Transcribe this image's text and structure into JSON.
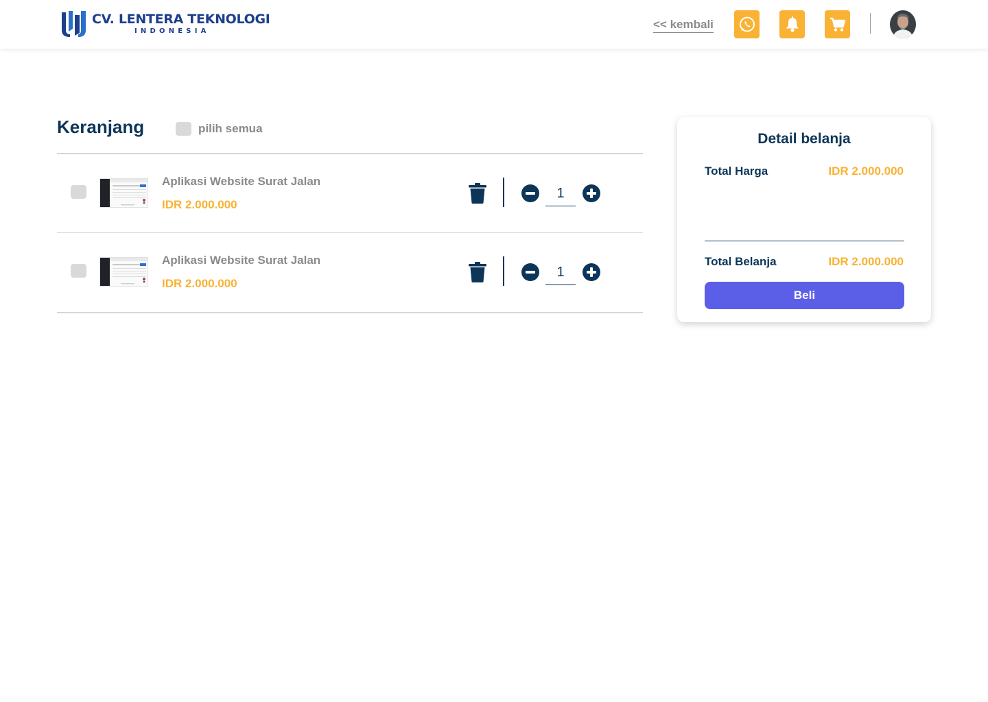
{
  "header": {
    "logo_title": "CV. LENTERA TEKNOLOGI",
    "logo_subtitle": "INDONESIA",
    "back_label": "<< kembali",
    "icons": [
      "whatsapp-icon",
      "bell-icon",
      "cart-icon"
    ],
    "accent_color": "#f9b233"
  },
  "cart": {
    "title": "Keranjang",
    "select_all_label": "pilih semua",
    "items": [
      {
        "name": "Aplikasi Website Surat Jalan",
        "price": "IDR 2.000.000",
        "quantity": "1"
      },
      {
        "name": "Aplikasi Website Surat Jalan",
        "price": "IDR 2.000.000",
        "quantity": "1"
      }
    ]
  },
  "summary": {
    "title": "Detail belanja",
    "total_price_label": "Total Harga",
    "total_price_value": "IDR 2.000.000",
    "total_label": "Total Belanja",
    "total_value": "IDR 2.000.000",
    "buy_label": "Beli",
    "button_color": "#5b5fe8"
  }
}
